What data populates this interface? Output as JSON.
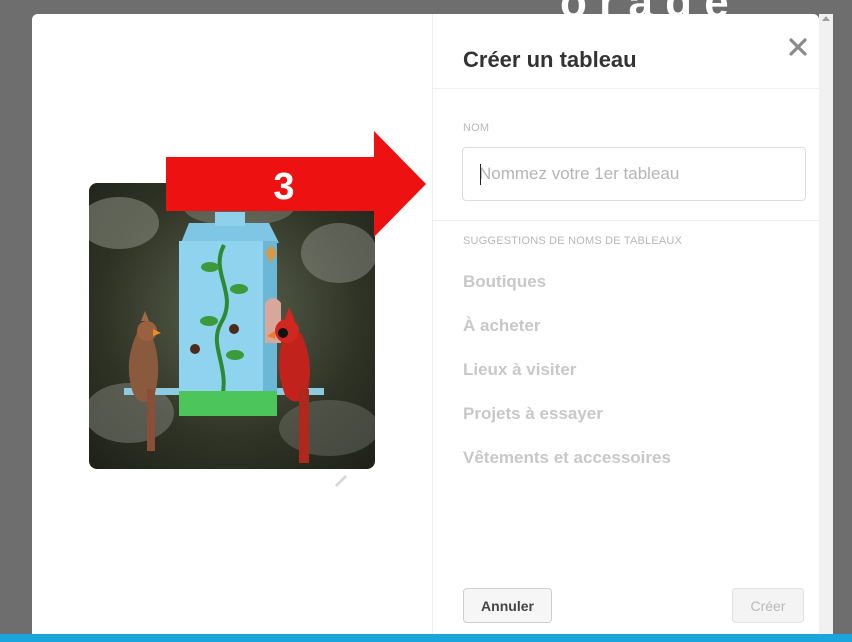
{
  "background": {
    "partial_text": "o r a g e"
  },
  "dialog": {
    "title": "Créer un tableau",
    "close_symbol": "✕",
    "name_section_label": "NOM",
    "name_input": {
      "placeholder": "Nommez votre 1er tableau",
      "value": ""
    },
    "suggestions_label": "SUGGESTIONS DE NOMS DE TABLEAUX",
    "suggestions": [
      {
        "label": "Boutiques"
      },
      {
        "label": "À acheter"
      },
      {
        "label": "Lieux à visiter"
      },
      {
        "label": "Projets à essayer"
      },
      {
        "label": "Vêtements et accessoires"
      }
    ],
    "cancel_label": "Annuler",
    "create_label": "Créer"
  },
  "annotation": {
    "step_number": "3",
    "arrow_color": "#ee1111"
  },
  "colors": {
    "accent_bar": "#1aa5dc",
    "overlay": "#6e6e6e"
  }
}
